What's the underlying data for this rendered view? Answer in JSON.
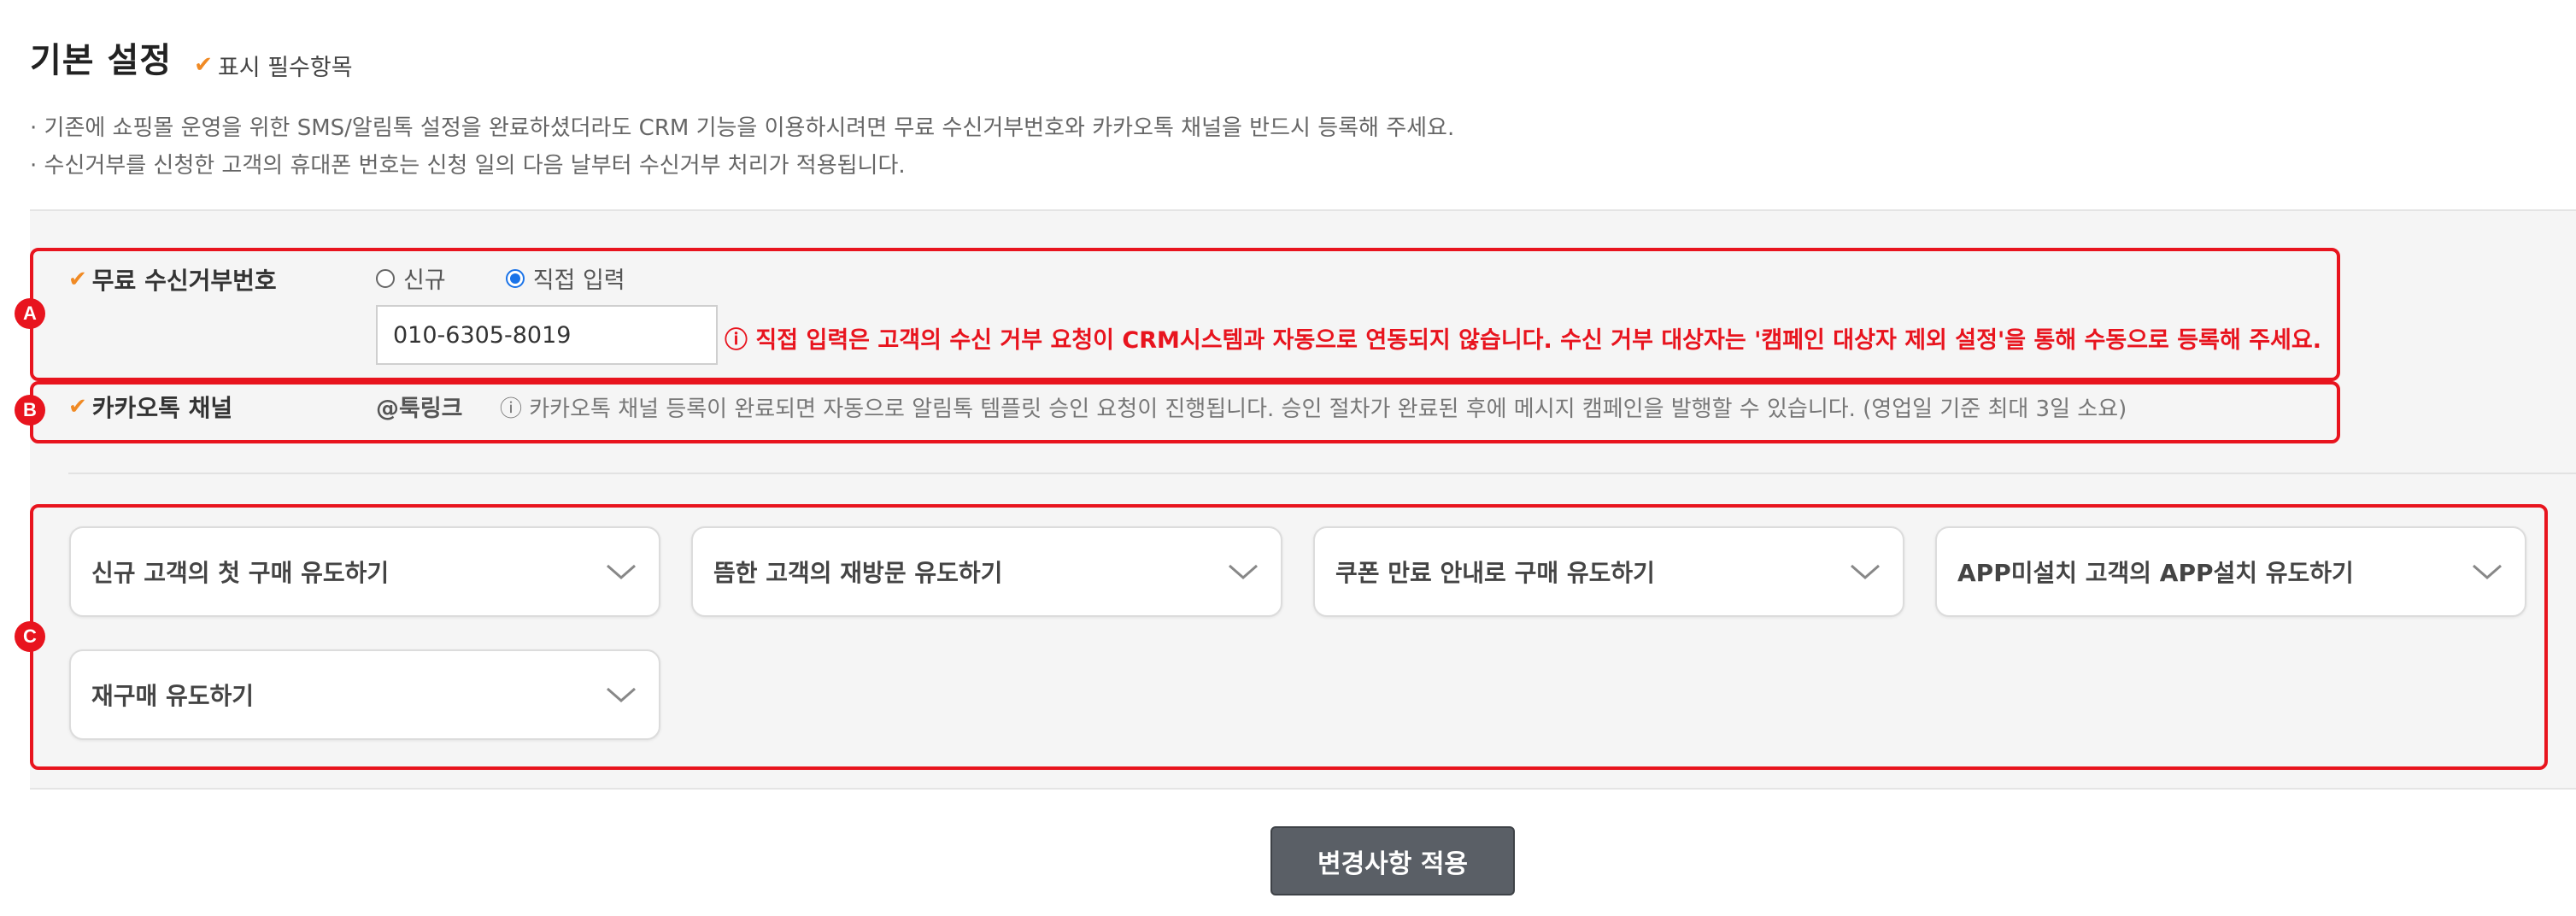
{
  "header": {
    "title": "기본 설정",
    "required_note": "표시 필수항목"
  },
  "notes": [
    "· 기존에 쇼핑몰 운영을 위한 SMS/알림톡 설정을 완료하셨더라도 CRM 기능을 이용하시려면 무료 수신거부번호와 카카오톡 채널을 반드시 등록해 주세요.",
    "· 수신거부를 신청한 고객의 휴대폰 번호는 신청 일의 다음 날부터 수신거부 처리가 적용됩니다."
  ],
  "badges": {
    "a": "A",
    "b": "B",
    "c": "C"
  },
  "optout": {
    "label": "무료 수신거부번호",
    "options": [
      "신규",
      "직접 입력"
    ],
    "selected": "직접 입력",
    "value": "010-6305-8019",
    "warning": "ⓘ 직접 입력은 고객의 수신 거부 요청이 CRM시스템과 자동으로 연동되지 않습니다. 수신 거부 대상자는 '캠페인 대상자 제외 설정'을 통해 수동으로 등록해 주세요."
  },
  "kakao": {
    "label": "카카오톡 채널",
    "channel": "@툭링크",
    "info": "ⓘ 카카오톡 채널 등록이 완료되면 자동으로 알림톡 템플릿 승인 요청이 진행됩니다. 승인 절차가 완료된 후에 메시지 캠페인을 발행할 수 있습니다. (영업일 기준 최대 3일 소요)"
  },
  "campaigns": [
    "신규 고객의 첫 구매 유도하기",
    "뜸한 고객의 재방문 유도하기",
    "쿠폰 만료 안내로 구매 유도하기",
    "APP미설치 고객의 APP설치 유도하기",
    "재구매 유도하기"
  ],
  "apply_label": "변경사항 적용",
  "colors": {
    "accent_red": "#e8141e",
    "check_orange": "#f08a24",
    "radio_blue": "#1a73e8",
    "button": "#5a5f66"
  }
}
